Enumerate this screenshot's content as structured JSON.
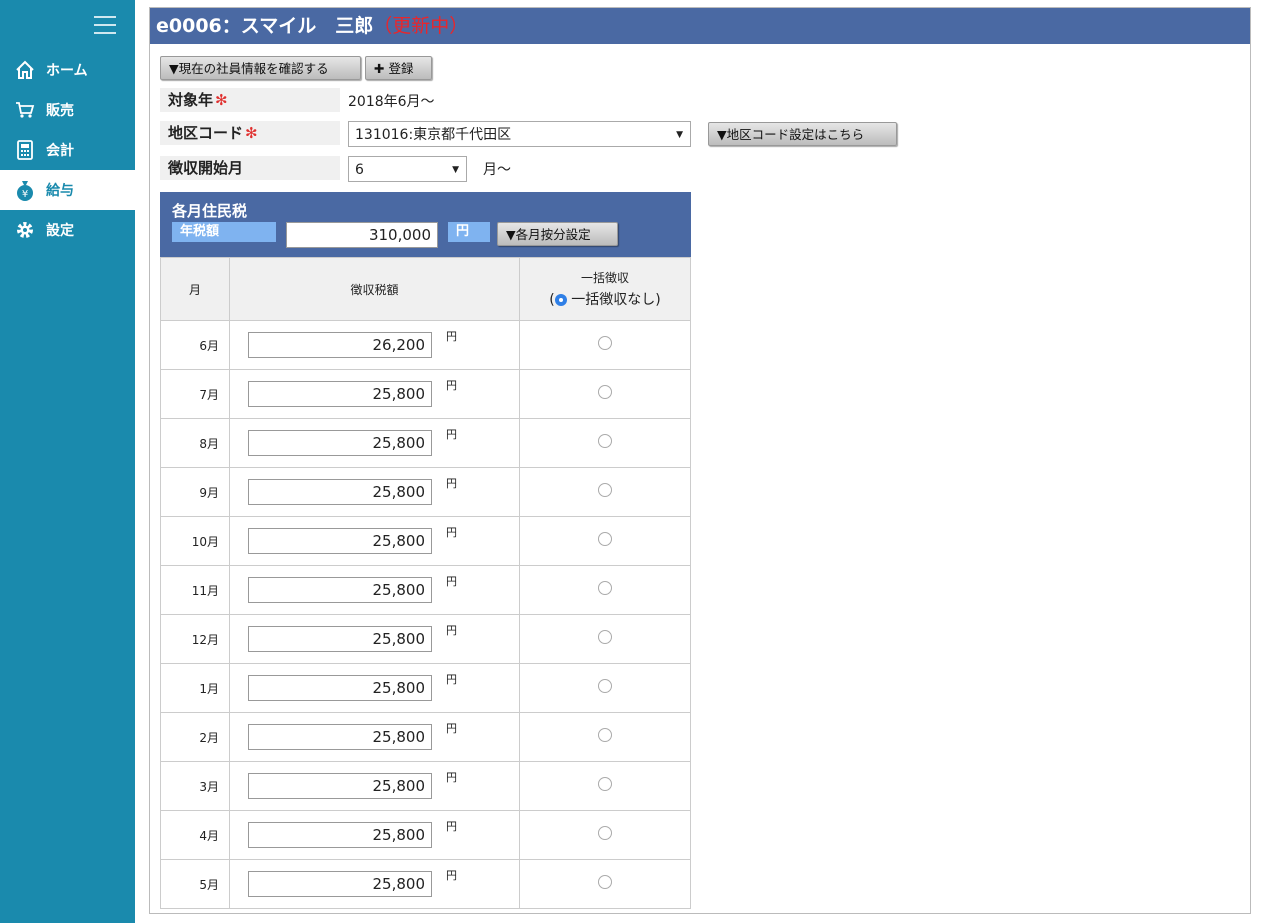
{
  "sidebar": {
    "items": [
      {
        "label": "ホーム",
        "icon": "home-icon"
      },
      {
        "label": "販売",
        "icon": "cart-icon"
      },
      {
        "label": "会計",
        "icon": "calculator-icon"
      },
      {
        "label": "給与",
        "icon": "money-bag-icon",
        "active": true
      },
      {
        "label": "設定",
        "icon": "gear-icon"
      }
    ]
  },
  "header": {
    "title": "e0006：スマイル　三郎",
    "status": "（更新中）"
  },
  "toolbar": {
    "confirm_label": "▼現在の社員情報を確認する",
    "register_label": "✚ 登録"
  },
  "form": {
    "target_year_label": "対象年",
    "target_year_value": "2018年6月〜",
    "region_label": "地区コード",
    "region_value": "131016:東京都千代田区",
    "region_button": "▼地区コード設定はこちら",
    "start_month_label": "徴収開始月",
    "start_month_value": "6",
    "start_month_suffix": "月〜",
    "required_mark": "✻"
  },
  "tax": {
    "title": "各月住民税",
    "annual_label": "年税額",
    "annual_value": "310,000",
    "yen_label": "円",
    "allocate_button": "▼各月按分設定",
    "col_month": "月",
    "col_amount": "徴収税額",
    "col_lump": "一括徴収",
    "lump_none_open": "(",
    "lump_none_label": "一括徴収なし)",
    "rows": [
      {
        "month": "6月",
        "amount": "26,200"
      },
      {
        "month": "7月",
        "amount": "25,800"
      },
      {
        "month": "8月",
        "amount": "25,800"
      },
      {
        "month": "9月",
        "amount": "25,800"
      },
      {
        "month": "10月",
        "amount": "25,800"
      },
      {
        "month": "11月",
        "amount": "25,800"
      },
      {
        "month": "12月",
        "amount": "25,800"
      },
      {
        "month": "1月",
        "amount": "25,800"
      },
      {
        "month": "2月",
        "amount": "25,800"
      },
      {
        "month": "3月",
        "amount": "25,800"
      },
      {
        "month": "4月",
        "amount": "25,800"
      },
      {
        "month": "5月",
        "amount": "25,800"
      }
    ],
    "row_yen": "円"
  },
  "colors": {
    "sidebar_bg": "#1a8aad",
    "header_bg": "#4a69a3",
    "status_red": "#e8262c",
    "badge_blue": "#7fb3f0"
  }
}
